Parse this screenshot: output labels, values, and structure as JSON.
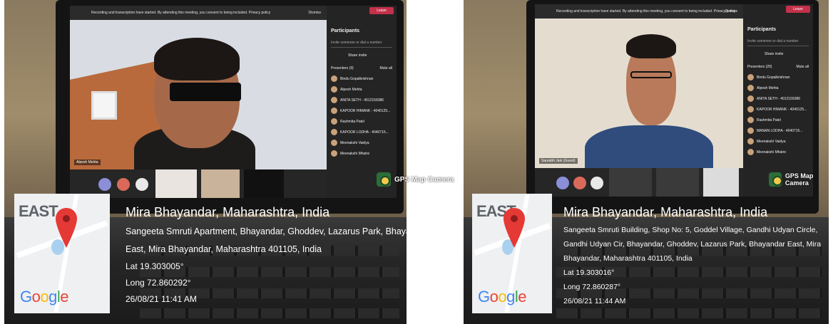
{
  "photos": [
    {
      "screen": {
        "notice": "Recording and transcription have started. By attending this meeting, you consent to being included. Privacy policy",
        "dismiss": "Dismiss",
        "leave": "Leave",
        "panel_title": "Participants",
        "invite_placeholder": "Invite someone or dial a number",
        "share_invite": "Share invite",
        "presenters_header": "Presenters (9)",
        "mute_all": "Mute all",
        "participants": [
          "Bindu Gopalkrishnan",
          "Alpesh Mehta",
          "ANITA SETH - 4012159386",
          "KAPOOR HIMANK - 4040125...",
          "Rashmita Patel",
          "KAPOOR LODHA - 4040715...",
          "Meenakshi Vaidya",
          "Meenakshi Mhatre"
        ],
        "tile_name": "Alpesh Mehta"
      },
      "gps": {
        "badge": "GPS Map Camera",
        "map_direction": "EAST",
        "map_brand": "Google",
        "city": "Mira Bhayandar, Maharashtra, India",
        "address": "Sangeeta Smruti Apartment, Bhayandar, Ghoddev, Lazarus Park, Bhayandar East, Mira Bhayandar, Maharashtra 401105, India",
        "lat": "Lat 19.303005°",
        "long": "Long 72.860292°",
        "datetime": "26/08/21 11:41 AM"
      }
    },
    {
      "screen": {
        "notice": "Recording and transcription have started. By attending this meeting, you consent to being included. Privacy policy",
        "dismiss": "Dismiss",
        "leave": "Leave",
        "panel_title": "Participants",
        "invite_placeholder": "Invite someone or dial a number",
        "share_invite": "Share invite",
        "presenters_header": "Presenters (20)",
        "mute_all": "Mute all",
        "participants": [
          "Bindu Gopalkrishnan",
          "Alpesh Mehta",
          "ANITA SETH - 4012159386",
          "KAPOOR HIMANK - 4040125...",
          "Rashmita Patel",
          "MANAN LODHA - 4040715...",
          "Meenakshi Vaidya",
          "Meenakshi Mhatre"
        ],
        "tile_name": "Saurabh Jain (Guest)"
      },
      "gps": {
        "badge": "GPS Map Camera",
        "map_direction": "EAST",
        "map_brand": "Google",
        "city": "Mira Bhayandar, Maharashtra, India",
        "address": "Sangeeta Smruti Building, Shop No: 5, Goddel Village, Gandhi Udyan Circle, Gandhi Udyan Cir, Bhayandar, Ghoddev, Lazarus Park, Bhayandar East, Mira Bhayandar, Maharashtra 401105, India",
        "lat": "Lat 19.303016°",
        "long": "Long 72.860287°",
        "datetime": "26/08/21 11:44 AM"
      }
    }
  ],
  "colors": {
    "google_blue": "#4285F4",
    "google_red": "#EA4335",
    "google_yellow": "#FBBC05",
    "google_green": "#34A853",
    "pin_red": "#E53935",
    "teams_leave": "#C4314B"
  }
}
